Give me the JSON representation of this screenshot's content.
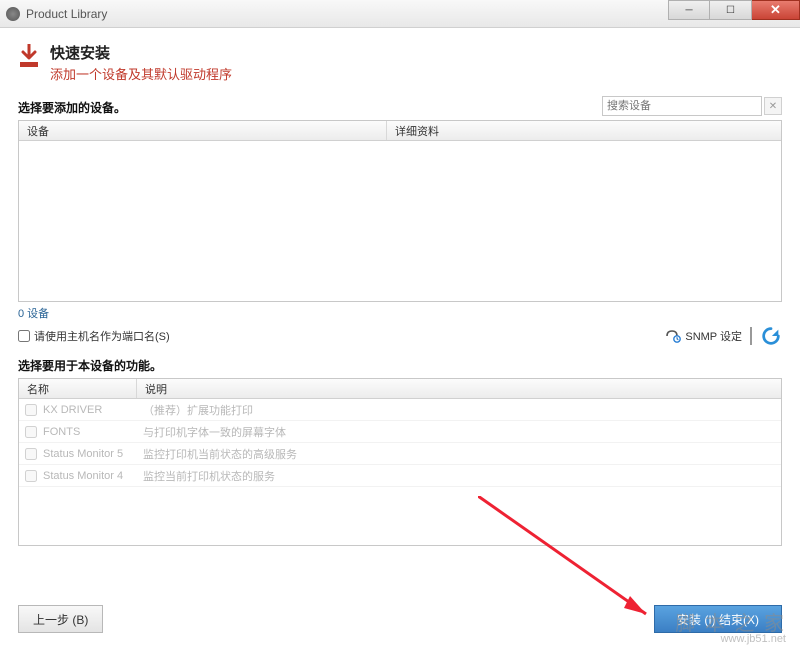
{
  "window": {
    "title": "Product Library"
  },
  "header": {
    "title": "快速安装",
    "subtitle": "添加一个设备及其默认驱动程序"
  },
  "section1": {
    "label": "选择要添加的设备。",
    "search_placeholder": "搜索设备",
    "columns": {
      "device": "设备",
      "detail": "详细资料"
    },
    "count_text": "0 设备"
  },
  "hostname_checkbox": {
    "label": "请使用主机名作为端口名(S)"
  },
  "snmp": {
    "label": "SNMP 设定"
  },
  "section2": {
    "label": "选择要用于本设备的功能。",
    "columns": {
      "name": "名称",
      "desc": "说明"
    },
    "rows": [
      {
        "name": "KX DRIVER",
        "desc": "（推荐）扩展功能打印"
      },
      {
        "name": "FONTS",
        "desc": "与打印机字体一致的屏幕字体"
      },
      {
        "name": "Status Monitor 5",
        "desc": "监控打印机当前状态的高级服务"
      },
      {
        "name": "Status Monitor 4",
        "desc": "监控当前打印机状态的服务"
      }
    ]
  },
  "buttons": {
    "back": "上一步 (B)",
    "install": "安装 (I)     结束(X)"
  },
  "watermark": {
    "text": "脚 本 之 家",
    "url": "www.jb51.net"
  }
}
